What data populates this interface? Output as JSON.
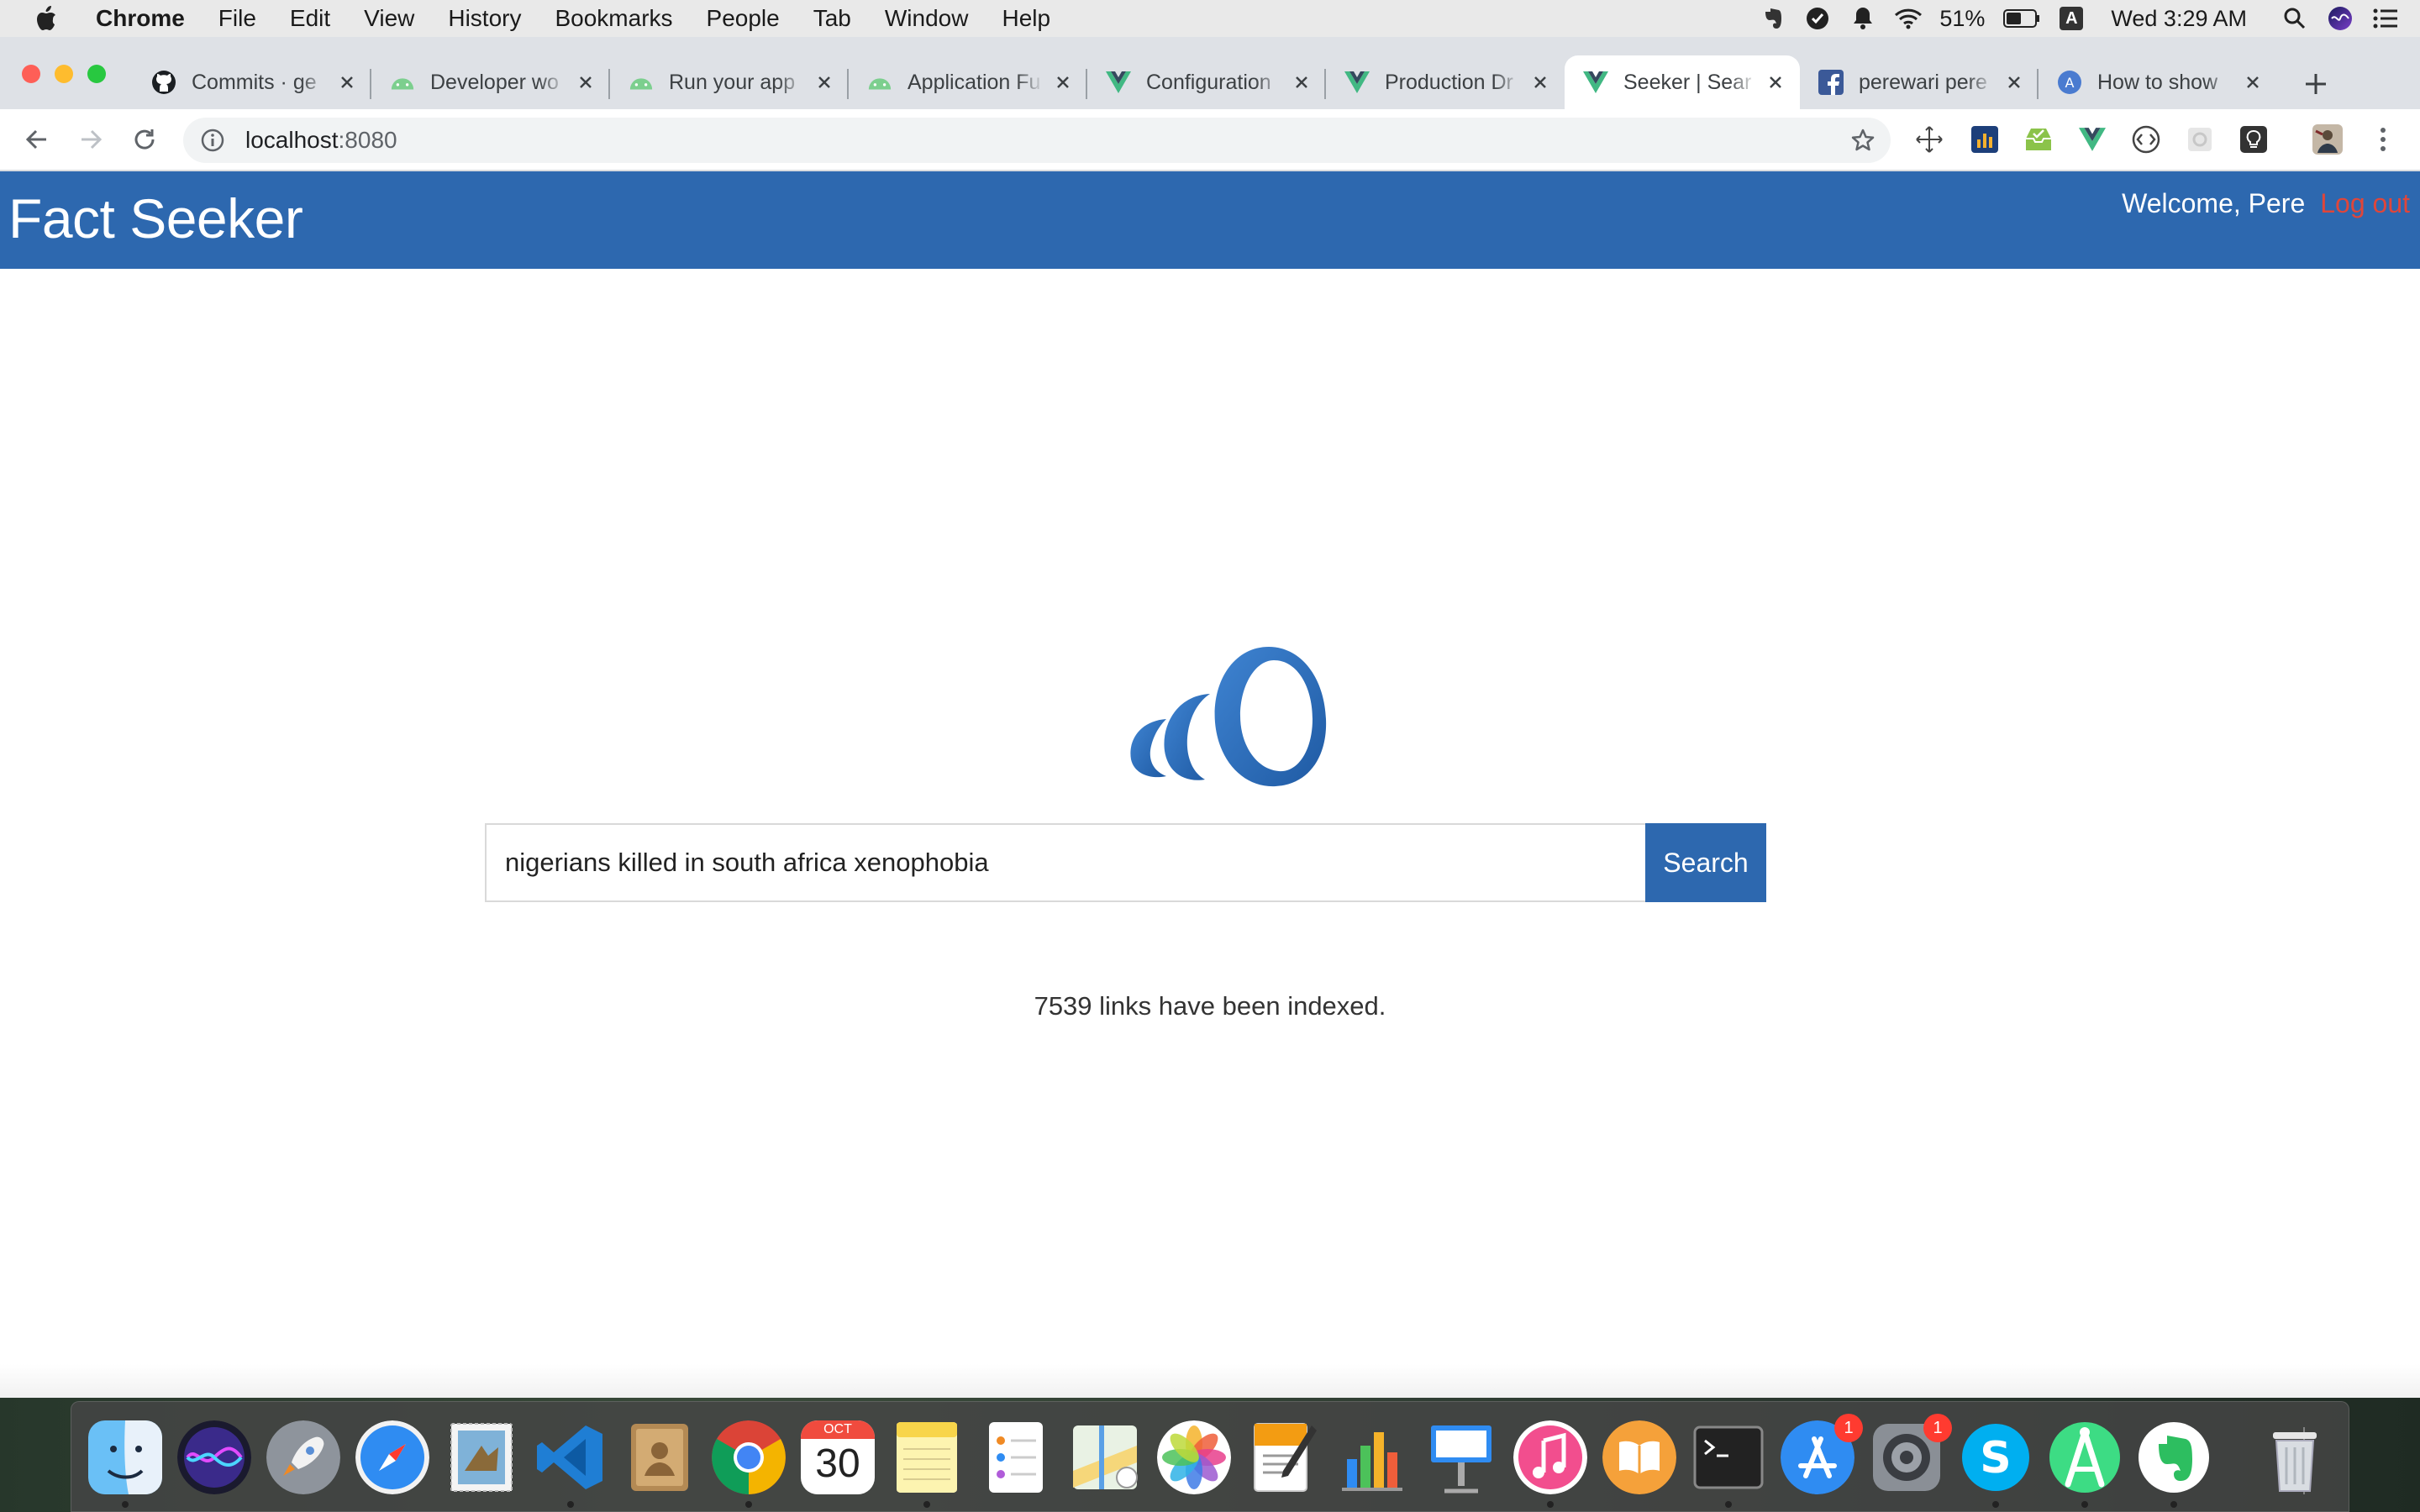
{
  "menubar": {
    "app": "Chrome",
    "items": [
      "File",
      "Edit",
      "View",
      "History",
      "Bookmarks",
      "People",
      "Tab",
      "Window",
      "Help"
    ],
    "battery": "51%",
    "input_source": "A",
    "clock": "Wed 3:29 AM"
  },
  "tabs": [
    {
      "title": "Commits · ge",
      "favicon": "github-icon"
    },
    {
      "title": "Developer wo",
      "favicon": "android-icon"
    },
    {
      "title": "Run your app",
      "favicon": "android-icon"
    },
    {
      "title": "Application Fu",
      "favicon": "android-icon"
    },
    {
      "title": "Configuration",
      "favicon": "vue-icon"
    },
    {
      "title": "Production Dr",
      "favicon": "vue-icon"
    },
    {
      "title": "Seeker | Sear",
      "favicon": "vue-icon",
      "active": true
    },
    {
      "title": "perewari pere",
      "favicon": "facebook-icon"
    },
    {
      "title": "How to show",
      "favicon": "atom-icon"
    }
  ],
  "toolbar": {
    "url_host": "localhost",
    "url_port": ":8080"
  },
  "app": {
    "brand": "Fact Seeker",
    "welcome": "Welcome, Pere",
    "logout": "Log out",
    "search_value": "nigerians killed in south africa xenophobia",
    "search_button": "Search",
    "indexed_text": "7539 links have been indexed.",
    "brand_color": "#2d68af",
    "logout_color": "#e0463a"
  },
  "dock": {
    "calendar_month": "OCT",
    "calendar_day": "30",
    "app_store_badge": "1",
    "system_prefs_badge": "1"
  }
}
